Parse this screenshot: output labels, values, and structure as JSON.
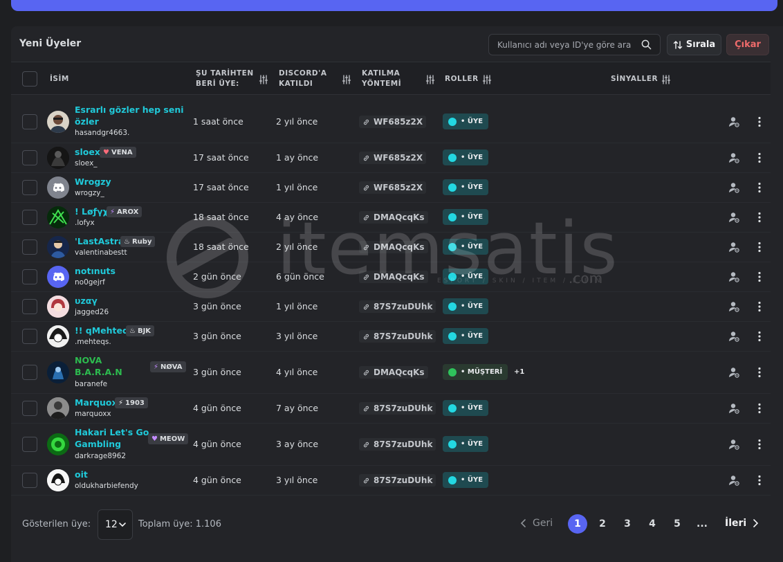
{
  "panel": {
    "title": "Yeni Üyeler",
    "search_placeholder": "Kullanıcı adı veya ID'ye göre ara",
    "sort_label": "Sırala",
    "exit_label": "Çıkar"
  },
  "columns": {
    "name": "İSİM",
    "member_since_1": "ŞU TARİHTEN",
    "member_since_2": "BERİ ÜYE:",
    "discord_joined_1": "DISCORD'A",
    "discord_joined_2": "KATILDI",
    "join_method_1": "KATILMA",
    "join_method_2": "YÖNTEMİ",
    "roles": "ROLLER",
    "signals": "SİNYALLER"
  },
  "rows": [
    {
      "name": "Esrarlı gözler hep seni özler",
      "handle": "hasandgr4663.",
      "since": "1 saat önce",
      "joined": "2 yıl önce",
      "invite": "WF685z2X",
      "role": "ÜYE"
    },
    {
      "name": "sloex",
      "handle": "sloex_",
      "tag": "VENA",
      "since": "17 saat önce",
      "joined": "1 ay önce",
      "invite": "WF685z2X",
      "role": "ÜYE"
    },
    {
      "name": "Wrogzy",
      "handle": "wrogzy_",
      "since": "17 saat önce",
      "joined": "1 yıl önce",
      "invite": "WF685z2X",
      "role": "ÜYE"
    },
    {
      "name": "! Løƒγχ",
      "handle": ".lofyx",
      "tag": "AROX",
      "since": "18 saat önce",
      "joined": "4 ay önce",
      "invite": "DMAQcqKs",
      "role": "ÜYE"
    },
    {
      "name": "'LastAstra",
      "handle": "valentinabestt",
      "tag": "Ruby",
      "since": "18 saat önce",
      "joined": "2 yıl önce",
      "invite": "DMAQcqKs",
      "role": "ÜYE"
    },
    {
      "name": "notınuts",
      "handle": "no0gejrf",
      "since": "2 gün önce",
      "joined": "6 gün önce",
      "invite": "DMAQcqKs",
      "role": "ÜYE"
    },
    {
      "name": "υzαγ",
      "handle": "jagged26",
      "since": "3 gün önce",
      "joined": "1 yıl önce",
      "invite": "87S7zuDUhk",
      "role": "ÜYE"
    },
    {
      "name": "!! qMehteqs.",
      "handle": ".mehteqs.",
      "tag": "BJK",
      "since": "3 gün önce",
      "joined": "3 yıl önce",
      "invite": "87S7zuDUhk",
      "role": "ÜYE"
    },
    {
      "name": "NOVA B.A.R.A.N",
      "name_top": "NOVA",
      "name_bottom": "B.A.R.A.N",
      "handle": "baranefe",
      "tag": "NØVA",
      "since": "3 gün önce",
      "joined": "4 yıl önce",
      "invite": "DMAQcqKs",
      "role": "MÜŞTERİ",
      "more_roles": "+1"
    },
    {
      "name": "Marquox",
      "handle": "marquoxx",
      "tag": "1903",
      "since": "4 gün önce",
      "joined": "7 ay önce",
      "invite": "87S7zuDUhk",
      "role": "ÜYE"
    },
    {
      "name": "Hakari Let's Go Gambling",
      "handle": "darkrage8962",
      "tag": "MEOW",
      "since": "4 gün önce",
      "joined": "3 ay önce",
      "invite": "87S7zuDUhk",
      "role": "ÜYE"
    },
    {
      "name": "oit",
      "handle": "oldukharbiefendy",
      "since": "4 gün önce",
      "joined": "3 yıl önce",
      "invite": "87S7zuDUhk",
      "role": "ÜYE"
    }
  ],
  "footer": {
    "shown_label": "Gösterilen üye:",
    "per_page": "12",
    "total_label": "Toplam üye: 1.106",
    "prev": "Geri",
    "next": "İleri",
    "pages": [
      "1",
      "2",
      "3",
      "4",
      "5",
      "..."
    ],
    "active_page": "1"
  },
  "watermark": {
    "text": "itemsatis",
    "sub": "ESPORT / SKIN / ITEM / E-PIN",
    "com": ".com"
  },
  "colors": {
    "accent": "#5865f2",
    "username": "#20c9d9",
    "role_uye": "#23d8e2",
    "role_musteri": "#2fc35c",
    "exit": "#f06b6b"
  }
}
